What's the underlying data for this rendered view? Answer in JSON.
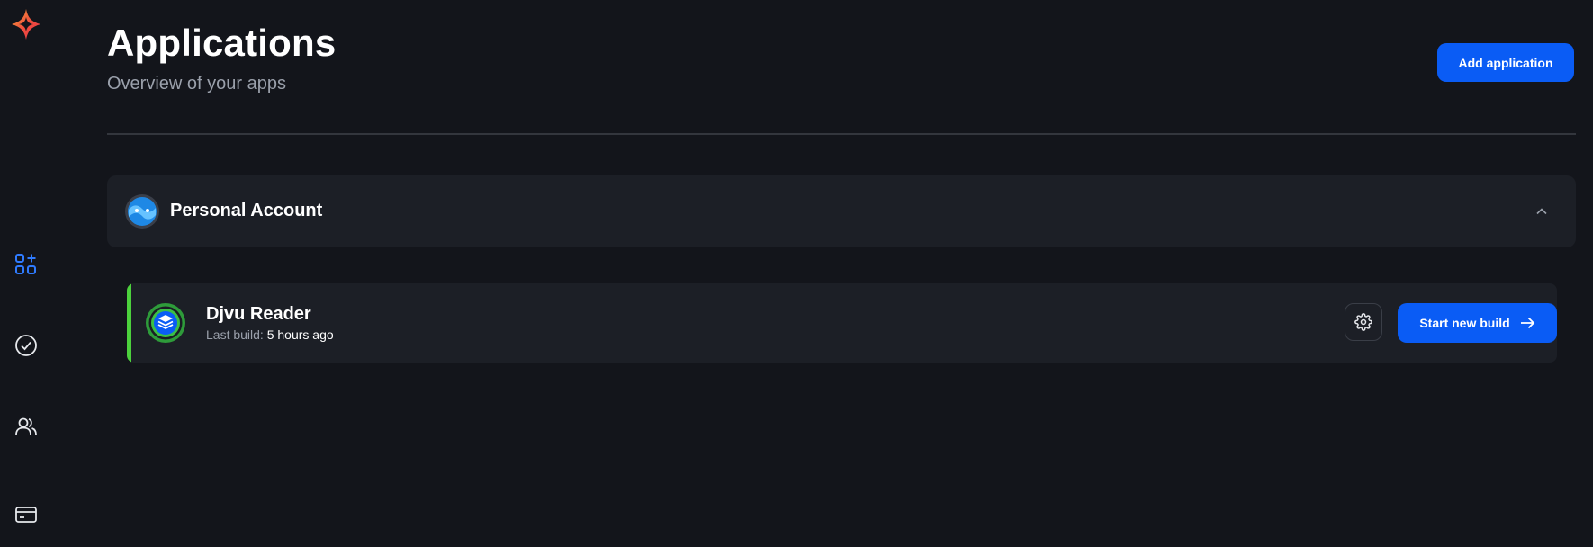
{
  "sidebar": {
    "logo_icon": "sparkle-logo-icon",
    "items": [
      {
        "icon": "apps-grid-plus-icon",
        "active": true
      },
      {
        "icon": "check-circle-icon",
        "active": false
      },
      {
        "icon": "users-icon",
        "active": false
      },
      {
        "icon": "credit-card-icon",
        "active": false
      }
    ]
  },
  "header": {
    "title": "Applications",
    "subtitle": "Overview of your apps",
    "add_button_label": "Add application"
  },
  "account": {
    "name": "Personal Account",
    "avatar_icon": "account-avatar-icon",
    "expanded": true
  },
  "apps": [
    {
      "name": "Djvu Reader",
      "last_build_label": "Last build:",
      "last_build_value": "5 hours ago",
      "icon": "layers-app-icon",
      "status_color": "#4cd13d",
      "build_button_label": "Start new build"
    }
  ],
  "colors": {
    "background": "#13151b",
    "card": "#1c1f26",
    "accent": "#0a5cf5",
    "success": "#4cd13d",
    "muted_text": "#9aa0ab"
  }
}
